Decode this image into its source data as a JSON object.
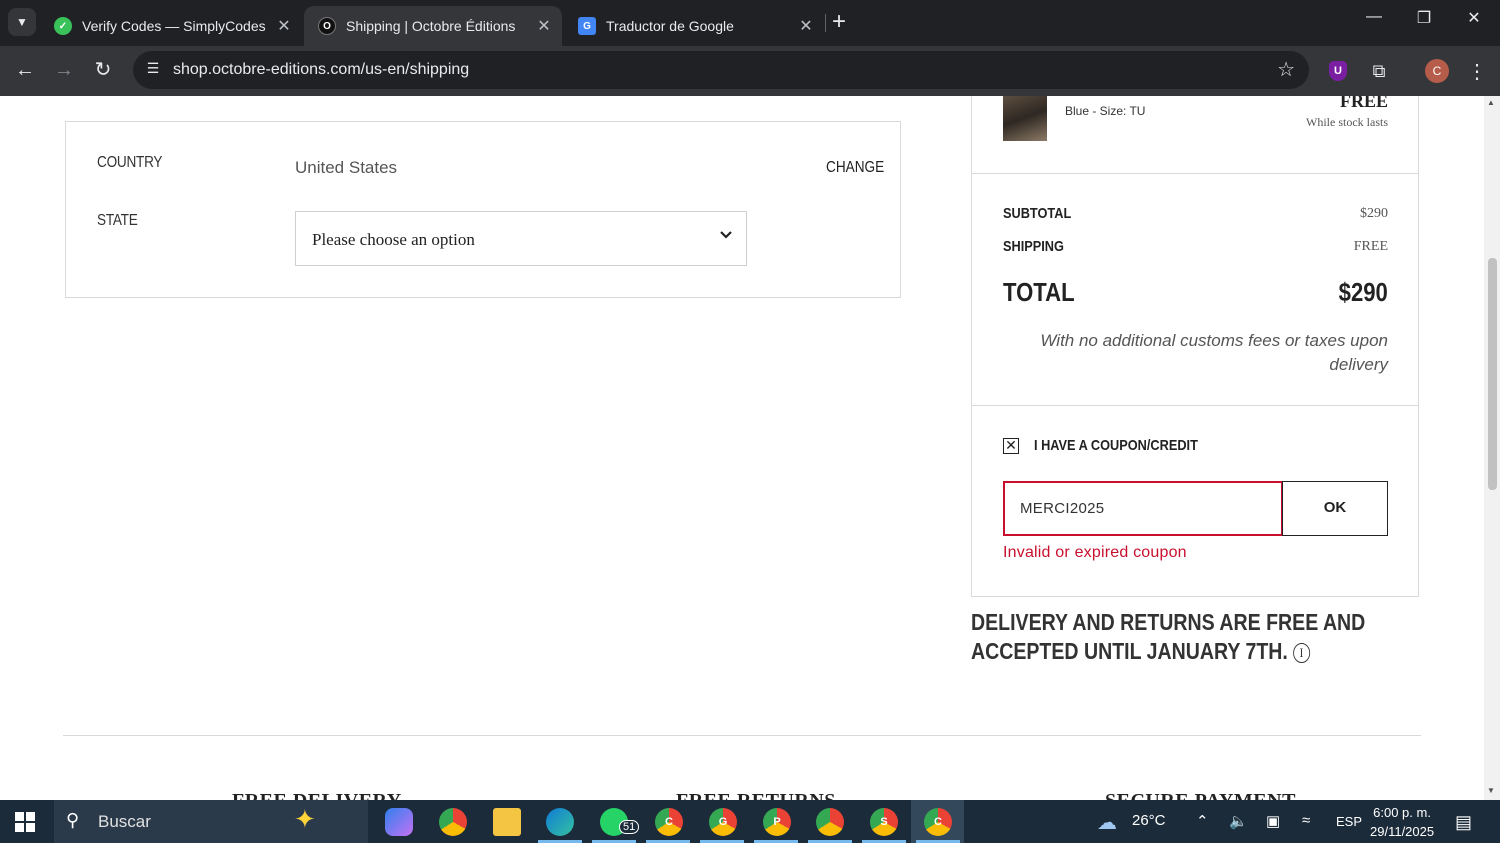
{
  "browser": {
    "tabs": [
      {
        "title": "Verify Codes — SimplyCodes",
        "favicon": "simplycodes-icon",
        "active": false
      },
      {
        "title": "Shipping | Octobre Éditions",
        "favicon": "octobre-icon",
        "active": true
      },
      {
        "title": "Traductor de Google",
        "favicon": "google-translate-icon",
        "active": false
      }
    ],
    "url": "shop.octobre-editions.com/us-en/shipping",
    "profile_initial": "C",
    "extension_label": "U"
  },
  "shipping_form": {
    "country_label": "COUNTRY",
    "country_value": "United States",
    "change_label": "CHANGE",
    "state_label": "STATE",
    "state_value": "Please choose an option"
  },
  "order_summary": {
    "product_variant": "Blue - Size: TU",
    "product_price": "FREE",
    "product_stock": "While stock lasts",
    "subtotal_label": "SUBTOTAL",
    "subtotal_value": "$290",
    "shipping_label": "SHIPPING",
    "shipping_value": "FREE",
    "total_label": "TOTAL",
    "total_value": "$290",
    "customs_note": "With no additional customs fees or taxes upon delivery",
    "coupon_toggle_label": "I HAVE A COUPON/CREDIT",
    "coupon_toggle_mark": "✕",
    "coupon_code": "MERCI2025",
    "coupon_ok_label": "OK",
    "coupon_error": "Invalid or expired coupon",
    "accent_error_color": "#c8102e"
  },
  "returns_note": "DELIVERY AND RETURNS ARE FREE AND ACCEPTED UNTIL JANUARY 7TH.",
  "footer": {
    "items": [
      "FREE DELIVERY",
      "FREE RETURNS",
      "SECURE PAYMENT"
    ]
  },
  "taskbar": {
    "search_placeholder": "Buscar",
    "whatsapp_badge": "51",
    "weather": "26°C",
    "language": "ESP",
    "time": "6:00 p. m.",
    "date": "29/11/2025",
    "chrome_profiles": [
      "C",
      "G",
      "P",
      "S",
      "C"
    ]
  }
}
